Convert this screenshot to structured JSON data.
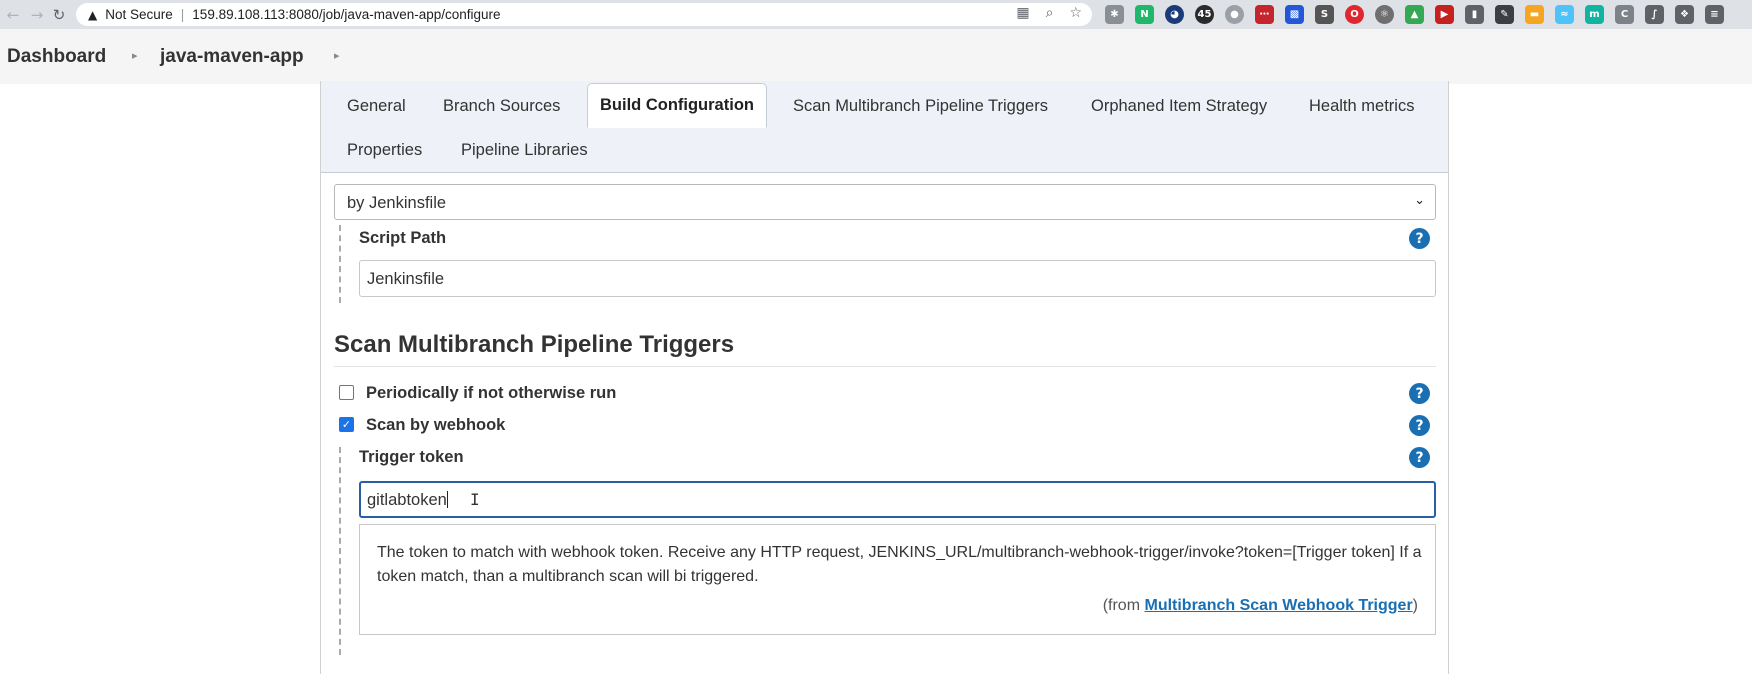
{
  "browser": {
    "security_label": "Not Secure",
    "url": "159.89.108.113:8080/job/java-maven-app/configure"
  },
  "breadcrumb": {
    "items": [
      "Dashboard",
      "java-maven-app"
    ]
  },
  "tabs": [
    {
      "label": "General",
      "active": false
    },
    {
      "label": "Branch Sources",
      "active": false
    },
    {
      "label": "Build Configuration",
      "active": true
    },
    {
      "label": "Scan Multibranch Pipeline Triggers",
      "active": false
    },
    {
      "label": "Orphaned Item Strategy",
      "active": false
    },
    {
      "label": "Health metrics",
      "active": false
    },
    {
      "label": "Properties",
      "active": false
    },
    {
      "label": "Pipeline Libraries",
      "active": false
    }
  ],
  "build_configuration": {
    "mode_selected": "by Jenkinsfile",
    "script_path_label": "Script Path",
    "script_path_value": "Jenkinsfile"
  },
  "triggers": {
    "title": "Scan Multibranch Pipeline Triggers",
    "periodically_label": "Periodically if not otherwise run",
    "periodically_checked": false,
    "webhook_label": "Scan by webhook",
    "webhook_checked": true,
    "token_label": "Trigger token",
    "token_value": "gitlabtoken",
    "help_text": "The token to match with webhook token. Receive any HTTP request, JENKINS_URL/multibranch-webhook-trigger/invoke?token=[Trigger token] If a token match, than a multibranch scan will bi triggered.",
    "help_from_prefix": "(from ",
    "help_from_link": "Multibranch Scan Webhook Trigger",
    "help_from_suffix": ")"
  },
  "colors": {
    "accent": "#1a6fb3",
    "tabbar_bg": "#eef2f8",
    "focus_border": "#2a5fa8"
  }
}
